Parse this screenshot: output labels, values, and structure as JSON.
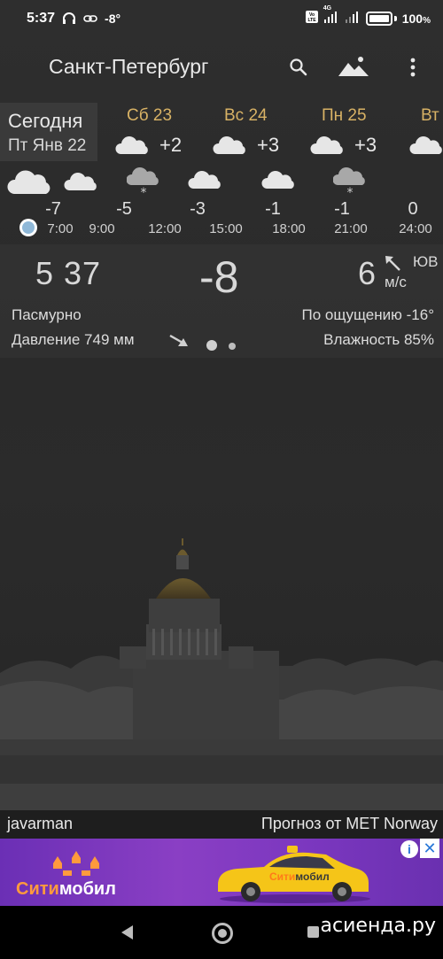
{
  "status_bar": {
    "time": "5:37",
    "temp": "-8°",
    "battery": "100",
    "battery_unit": "%",
    "network": "4G"
  },
  "appbar": {
    "city": "Санкт-Петербург",
    "search_icon": "search-icon",
    "wallpaper_icon": "landscape-icon",
    "menu_icon": "more-vert-icon"
  },
  "today": {
    "label": "Сегодня",
    "date": "Пт Янв 22"
  },
  "days": [
    {
      "name": "Сб 23",
      "temp": "+2"
    },
    {
      "name": "Вс 24",
      "temp": "+3"
    },
    {
      "name": "Пн 25",
      "temp": "+3"
    },
    {
      "name": "Вт",
      "temp": ""
    }
  ],
  "hourly": [
    {
      "temp": "-7",
      "time": "7:00",
      "snow": false
    },
    {
      "temp": "-5",
      "time": "9:00",
      "snow": false
    },
    {
      "temp": "",
      "time": "12:00",
      "snow": true
    },
    {
      "temp": "-3",
      "time": "15:00",
      "snow": false
    },
    {
      "temp": "-1",
      "time": "18:00",
      "snow": false
    },
    {
      "temp": "-1",
      "time": "21:00",
      "snow": true
    },
    {
      "temp": "0",
      "time": "24:00",
      "snow": false
    }
  ],
  "current": {
    "time": "5 37",
    "temp": "-8",
    "wind_speed": "6",
    "wind_dir": "ЮВ",
    "wind_unit": "м/с",
    "condition": "Пасмурно",
    "feels_like": "По ощущению -16°",
    "pressure": "Давление 749 мм",
    "humidity": "Влажность 85%"
  },
  "footer": {
    "author": "javarman",
    "source": "Прогноз от MET Norway"
  },
  "ad": {
    "brand_part1": "Сити",
    "brand_part2": "мобил",
    "car_brand_part1": "Сити",
    "car_brand_part2": "мобил",
    "info": "i",
    "close": "✕"
  },
  "watermark": "асиенда.ру",
  "colors": {
    "day_name": "#d8b265",
    "accent_dot": "#8fb8d8",
    "ad_bg": "#7a3cb8",
    "ad_orange": "#ff9a3d"
  }
}
